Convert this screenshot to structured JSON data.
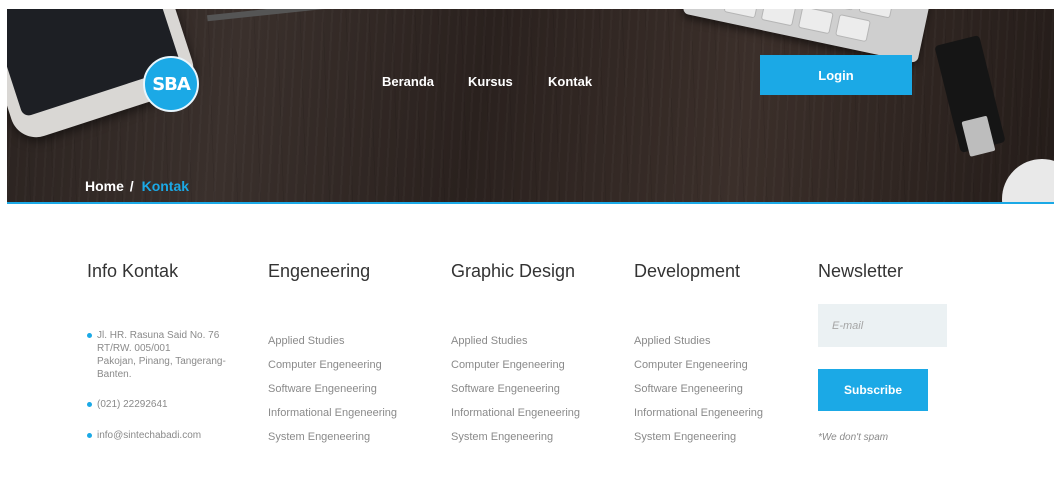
{
  "brand": {
    "logo_text": "SBA"
  },
  "nav": {
    "items": [
      {
        "label": "Beranda"
      },
      {
        "label": "Kursus"
      },
      {
        "label": "Kontak"
      }
    ],
    "login_label": "Login"
  },
  "breadcrumb": {
    "home": "Home",
    "separator": "/",
    "current": "Kontak"
  },
  "footer": {
    "info": {
      "title": "Info Kontak",
      "items": [
        {
          "lines": [
            "Jl. HR. Rasuna Said No. 76",
            "RT/RW. 005/001",
            "Pakojan, Pinang, Tangerang-",
            "Banten."
          ]
        },
        {
          "lines": [
            "(021) 22292641"
          ]
        },
        {
          "lines": [
            "info@sintechabadi.com"
          ]
        }
      ]
    },
    "columns": [
      {
        "title": "Engeneering",
        "links": [
          "Applied Studies",
          "Computer Engeneering",
          "Software Engeneering",
          "Informational Engeneering",
          "System Engeneering"
        ]
      },
      {
        "title": "Graphic Design",
        "links": [
          "Applied Studies",
          "Computer Engeneering",
          "Software Engeneering",
          "Informational Engeneering",
          "System Engeneering"
        ]
      },
      {
        "title": "Development",
        "links": [
          "Applied Studies",
          "Computer Engeneering",
          "Software Engeneering",
          "Informational Engeneering",
          "System Engeneering"
        ]
      }
    ],
    "newsletter": {
      "title": "Newsletter",
      "email_placeholder": "E-mail",
      "subscribe_label": "Subscribe",
      "note": "*We don't spam"
    }
  },
  "colors": {
    "accent": "#1ba9e6",
    "hero_bg": "#2e2522",
    "input_bg": "#ebf1f3"
  }
}
